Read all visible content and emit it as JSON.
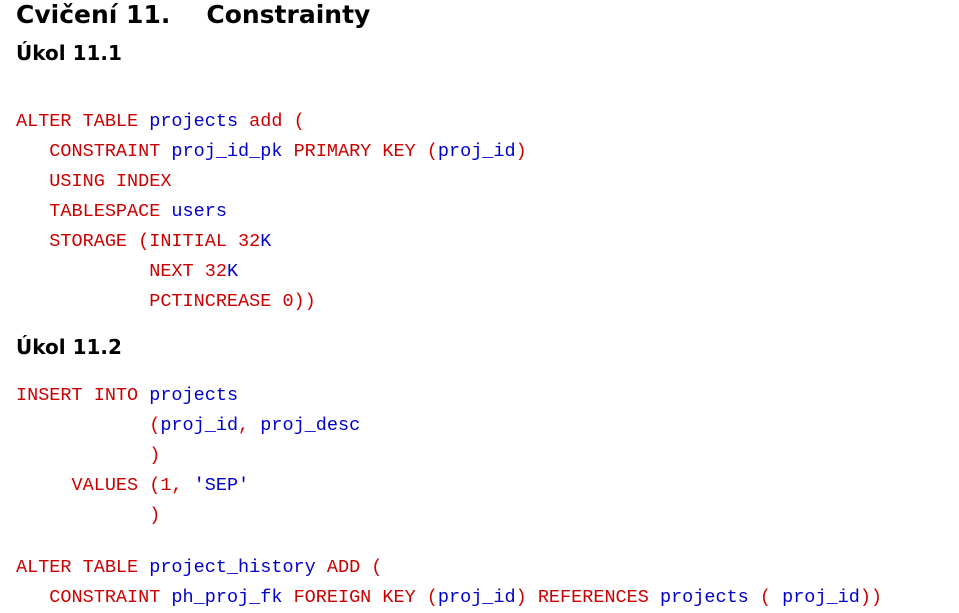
{
  "colors": {
    "keyword": "#cc0000",
    "identifier": "#0000cc",
    "text": "#000000"
  },
  "title": {
    "chapter_prefix": "Cvičení 11.",
    "chapter_name": "Constrainty"
  },
  "task1": {
    "label": "Úkol 11.1",
    "code": {
      "l1_kw": "ALTER TABLE",
      "l1_id": " projects ",
      "l1_kw2": "add (",
      "l2_kw": "   CONSTRAINT",
      "l2_id": " proj_id_pk ",
      "l2_kw2": "PRIMARY KEY (",
      "l2_id2": "proj_id",
      "l2_kw3": ")",
      "l3_kw": "   USING INDEX",
      "l4_kw": "   TABLESPACE",
      "l4_id": " users",
      "l5_kw": "   STORAGE (INITIAL 32",
      "l5_id": "K",
      "l6_kw": "            NEXT 32",
      "l6_id": "K",
      "l7_kw": "            PCTINCREASE 0))"
    }
  },
  "task2": {
    "label": "Úkol 11.2",
    "code_a": {
      "l1_kw": "INSERT INTO",
      "l1_id": " projects",
      "l2_kw": "            (",
      "l2_id": "proj_id",
      "l2_kw2": ",",
      "l2_id2": " proj_desc",
      "l3_kw": "            )",
      "l4_kw": "     VALUES (1,",
      "l4_str": " 'SEP'",
      "l5_kw": "            )"
    },
    "code_b": {
      "l1_kw": "ALTER TABLE",
      "l1_id": " project_history ",
      "l1_kw2": "ADD (",
      "l2_kw": "   CONSTRAINT",
      "l2_id": " ph_proj_fk ",
      "l2_kw2": "FOREIGN KEY (",
      "l2_id2": "proj_id",
      "l2_kw3": ") ",
      "l2_kw4": "REFERENCES",
      "l2_id3": " projects ",
      "l2_kw5": "(",
      "l2_id4": " proj_id",
      "l2_kw6": "))"
    }
  }
}
